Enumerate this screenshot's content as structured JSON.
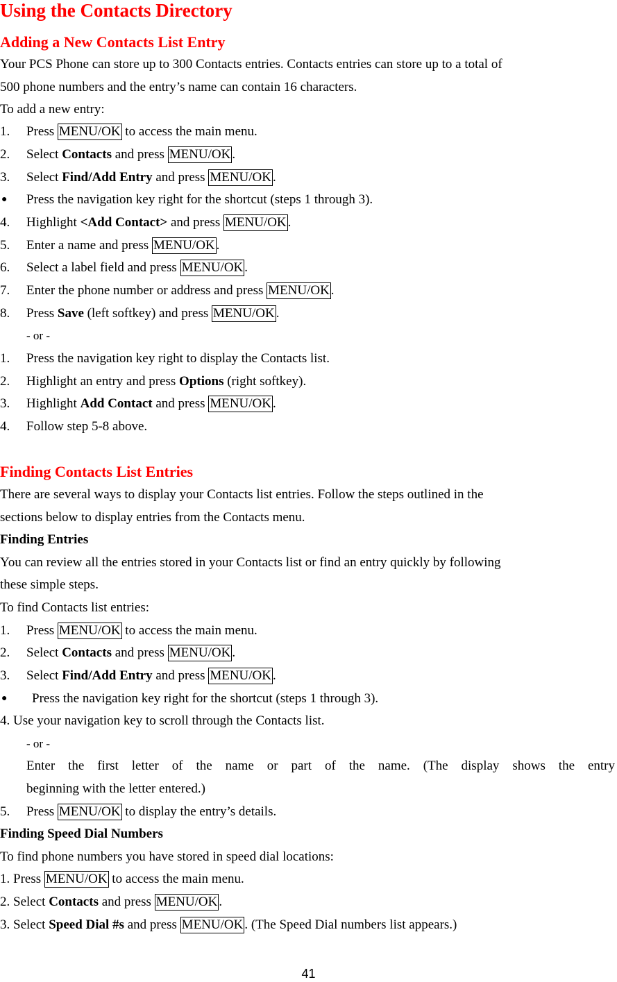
{
  "title": "Using the Contacts Directory",
  "section1": {
    "heading": "Adding a New Contacts List Entry",
    "intro_line1": "Your PCS Phone can store up to 300 Contacts entries. Contacts entries can store up to a total of",
    "intro_line2": "500 phone numbers and the entry’s name can contain 16 characters.",
    "to_add": "To add a new entry:",
    "steps": [
      {
        "num": "1.",
        "pre": "Press ",
        "key": "MENU/OK",
        "post": " to access the main menu."
      },
      {
        "num": "2.",
        "pre": "Select ",
        "bold": "Contacts",
        "mid": " and press ",
        "key": "MENU/OK",
        "post": "."
      },
      {
        "num": "3.",
        "pre": "Select ",
        "bold": "Find/Add Entry",
        "mid": " and press ",
        "key": "MENU/OK",
        "post": "."
      },
      {
        "num": "●",
        "pre": "Press the navigation key right for the shortcut (steps 1 through 3)."
      },
      {
        "num": "4.",
        "pre": "Highlight ",
        "bold": "<Add Contact>",
        "mid": " and press ",
        "key": "MENU/OK",
        "post": "."
      },
      {
        "num": "5.",
        "pre": "Enter a name and press ",
        "key": "MENU/OK",
        "post": "."
      },
      {
        "num": "6.",
        "pre": "Select a label field and press ",
        "key": "MENU/OK",
        "post": "."
      },
      {
        "num": "7.",
        "pre": "Enter the phone number or address and press ",
        "key": "MENU/OK",
        "post": "."
      },
      {
        "num": "8.",
        "pre": "Press ",
        "bold": "Save",
        "mid": " (left softkey) and press ",
        "key": "MENU/OK",
        "post": "."
      }
    ],
    "or": "- or -",
    "alt_steps": [
      {
        "num": "1.",
        "pre": "Press the navigation key right to display the Contacts list."
      },
      {
        "num": "2.",
        "pre": "Highlight an entry and press ",
        "bold": "Options",
        "mid": " (right softkey)."
      },
      {
        "num": "3.",
        "pre": "Highlight ",
        "bold": "Add Contact",
        "mid": " and press ",
        "key": "MENU/OK",
        "post": "."
      },
      {
        "num": "4.",
        "pre": "Follow step 5-8 above."
      }
    ]
  },
  "section2": {
    "heading": "Finding Contacts List Entries",
    "intro_line1": "There are several ways to display your Contacts list entries. Follow the steps outlined in the",
    "intro_line2": "sections below to display entries from the Contacts menu.",
    "sub1": {
      "heading": "Finding Entries",
      "desc_line1": "You can review all the entries stored in your Contacts list or find an entry quickly by following",
      "desc_line2": "these simple steps.",
      "to_find": "To find Contacts list entries:",
      "steps": [
        {
          "num": "1.",
          "pre": "Press ",
          "key": "MENU/OK",
          "post": " to access the main menu."
        },
        {
          "num": "2.",
          "pre": "Select ",
          "bold": "Contacts",
          "mid": " and press ",
          "key": "MENU/OK",
          "post": "."
        },
        {
          "num": "3.",
          "pre": "Select ",
          "bold": "Find/Add Entry",
          "mid": " and press ",
          "key": "MENU/OK",
          "post": "."
        },
        {
          "num": "●",
          "pre": "Press the navigation key right for the shortcut (steps 1 through 3)."
        }
      ],
      "step4": "4. Use your navigation key to scroll through the Contacts list.",
      "or": "- or -",
      "enter_line1": "Enter the first letter of the name or part of the name. (The display shows the entry",
      "enter_line2": "beginning with the letter entered.)",
      "step5": {
        "num": "5.",
        "pre": "Press ",
        "key": "MENU/OK",
        "post": " to display the entry’s details."
      }
    },
    "sub2": {
      "heading": "Finding Speed Dial Numbers",
      "to_find": "To find phone numbers you have stored in speed dial locations:",
      "steps": [
        {
          "num": "1. ",
          "pre": "Press ",
          "key": "MENU/OK",
          "post": " to access the main menu."
        },
        {
          "num": "2. ",
          "pre": "Select ",
          "bold": "Contacts",
          "mid": " and press ",
          "key": "MENU/OK",
          "post": "."
        },
        {
          "num": "3. ",
          "pre": "Select ",
          "bold": "Speed Dial #s",
          "mid": " and press ",
          "key": "MENU/OK",
          "post": ". (The Speed Dial numbers list appears.)"
        }
      ]
    }
  },
  "page_number": "41"
}
